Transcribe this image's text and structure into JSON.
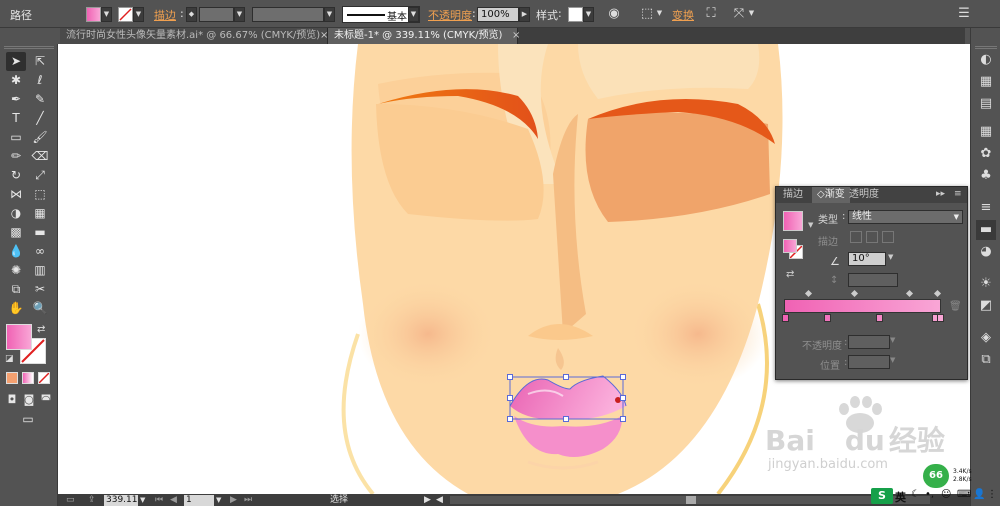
{
  "control_bar": {
    "object_type": "路径",
    "stroke_label": "描边",
    "stroke_style": "基本",
    "opacity_label": "不透明度",
    "opacity_value": "100%",
    "style_label": "样式",
    "transform_label": "变换"
  },
  "tabs": [
    {
      "label": "流行时尚女性头像矢量素材.ai* @ 66.67% (CMYK/预览)",
      "close": "×"
    },
    {
      "label": "未标题-1* @ 339.11% (CMYK/预览)",
      "close": "×"
    }
  ],
  "gradient_panel": {
    "tabs": [
      "描边",
      "渐变",
      "透明度"
    ],
    "type_label": "类型",
    "type_value": "线性",
    "stroke_label": "描边",
    "angle_value": "10°",
    "opacity_label": "不透明度",
    "location_label": "位置"
  },
  "status_bar": {
    "zoom": "339.11",
    "artboard": "1",
    "tool": "选择"
  },
  "watermark": {
    "brand": "Bai",
    "brand2": "du",
    "brand3": "经验",
    "url": "jingyan.baidu.com"
  },
  "tray": {
    "ime": "英",
    "net_up": "3.4K/s",
    "net_down": "2.8K/s",
    "badge": "66"
  },
  "colors": {
    "panel_bg": "#535353",
    "skin": "#fdd9a6",
    "skin_shadow": "#f5bd83",
    "eyebrow": "#e8621a",
    "lips": "#f27bc0",
    "gradient_start": "#f062b4",
    "gradient_end": "#f9a6d6",
    "accent_orange": "#f0a050"
  }
}
